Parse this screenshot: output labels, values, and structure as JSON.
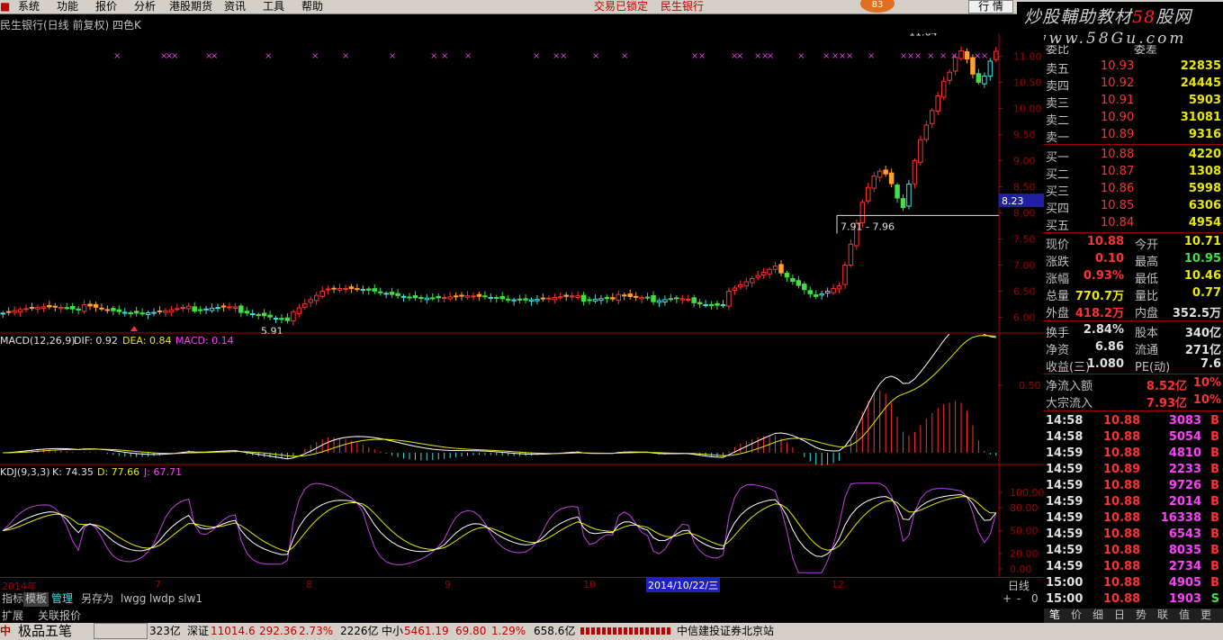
{
  "menu": {
    "items": [
      "系统",
      "功能",
      "报价",
      "分析",
      "港股期货",
      "资讯",
      "工具",
      "帮助"
    ],
    "lock_text": "交易已锁定",
    "stock_name": "民生银行",
    "badge": "83",
    "hangqing_button": "行 情"
  },
  "watermark": {
    "line1_a": "炒股輔助教材",
    "line1_b": "58",
    "line1_c": "股网",
    "line2": "www.58Gu.com"
  },
  "chart": {
    "title": "民生银行(日线 前复权) 四色K",
    "price_axis": [
      "11.00",
      "10.50",
      "10.00",
      "9.50",
      "9.00",
      "8.50",
      "8.00",
      "7.50",
      "7.00",
      "6.50",
      "6.00"
    ],
    "current_price_tag": "8.23",
    "range_label": "7.91 - 7.96",
    "high_label": "11.64",
    "low_label": "5.91",
    "top_label_left": "委比",
    "top_label_right": "委差"
  },
  "macd": {
    "name": "MACD(12,26,9)",
    "dif": "DIF: 0.92",
    "dea": "DEA: 0.84",
    "macd": "MACD: 0.14",
    "axis": "0.50"
  },
  "kdj": {
    "name": "KDJ(9,3,3)",
    "k": "K: 74.35",
    "d": "D: 77.66",
    "j": "J: 67.71",
    "axis": [
      "100.00",
      "80.00",
      "50.00",
      "20.00",
      "0.00"
    ]
  },
  "x_axis": {
    "labels": [
      "2014年",
      "7",
      "8",
      "9",
      "10",
      "12"
    ],
    "cursor_date": "2014/10/22/三",
    "period": "日线",
    "controls": [
      "+",
      "-",
      "0"
    ]
  },
  "bottom_tabs": [
    "指标",
    "模板",
    "管理",
    "另存为",
    "lwgg",
    "lwdp",
    "slw1"
  ],
  "quote": {
    "sell": [
      {
        "label": "卖五",
        "price": "10.93",
        "vol": "22835"
      },
      {
        "label": "卖四",
        "price": "10.92",
        "vol": "24445"
      },
      {
        "label": "卖三",
        "price": "10.91",
        "vol": "5903"
      },
      {
        "label": "卖二",
        "price": "10.90",
        "vol": "31081"
      },
      {
        "label": "卖一",
        "price": "10.89",
        "vol": "9316"
      }
    ],
    "buy": [
      {
        "label": "买一",
        "price": "10.88",
        "vol": "4220"
      },
      {
        "label": "买二",
        "price": "10.87",
        "vol": "1308"
      },
      {
        "label": "买三",
        "price": "10.86",
        "vol": "5998"
      },
      {
        "label": "买四",
        "price": "10.85",
        "vol": "6306"
      },
      {
        "label": "买五",
        "price": "10.84",
        "vol": "4954"
      }
    ],
    "stats": [
      {
        "l1": "现价",
        "v1": "10.88",
        "l2": "今开",
        "v2": "10.71"
      },
      {
        "l1": "涨跌",
        "v1": "0.10",
        "l2": "最高",
        "v2": "10.95"
      },
      {
        "l1": "涨幅",
        "v1": "0.93%",
        "l2": "最低",
        "v2": "10.46"
      },
      {
        "l1": "总量",
        "v1": "770.7万",
        "l2": "量比",
        "v2": "0.77"
      },
      {
        "l1": "外盘",
        "v1": "418.2万",
        "l2": "内盘",
        "v2": "352.5万"
      }
    ],
    "stats2": [
      {
        "l1": "换手",
        "v1": "2.84%",
        "l2": "股本",
        "v2": "340亿"
      },
      {
        "l1": "净资",
        "v1": "6.86",
        "l2": "流通",
        "v2": "271亿"
      },
      {
        "l1": "收益(三)",
        "v1": "1.080",
        "l2": "PE(动)",
        "v2": "7.6"
      }
    ],
    "flows": [
      {
        "label": "净流入额",
        "value": "8.52亿",
        "pct": "10%"
      },
      {
        "label": "大宗流入",
        "value": "7.93亿",
        "pct": "10%"
      }
    ],
    "ticks": [
      {
        "time": "14:58",
        "price": "10.88",
        "vol": "3083",
        "bs": "B"
      },
      {
        "time": "14:58",
        "price": "10.88",
        "vol": "5054",
        "bs": "B"
      },
      {
        "time": "14:59",
        "price": "10.88",
        "vol": "4810",
        "bs": "B"
      },
      {
        "time": "14:59",
        "price": "10.89",
        "vol": "2233",
        "bs": "B"
      },
      {
        "time": "14:59",
        "price": "10.88",
        "vol": "9726",
        "bs": "B"
      },
      {
        "time": "14:59",
        "price": "10.88",
        "vol": "2014",
        "bs": "B"
      },
      {
        "time": "14:59",
        "price": "10.88",
        "vol": "16338",
        "bs": "B"
      },
      {
        "time": "14:59",
        "price": "10.88",
        "vol": "6543",
        "bs": "B"
      },
      {
        "time": "14:59",
        "price": "10.88",
        "vol": "8035",
        "bs": "B"
      },
      {
        "time": "14:59",
        "price": "10.88",
        "vol": "2734",
        "bs": "B"
      },
      {
        "time": "15:00",
        "price": "10.88",
        "vol": "4905",
        "bs": "B"
      },
      {
        "time": "15:00",
        "price": "10.88",
        "vol": "1903",
        "bs": "S"
      }
    ]
  },
  "right_tabs": [
    "笔",
    "价",
    "细",
    "日",
    "势",
    "联",
    "值",
    "更"
  ],
  "extra_tabs": [
    "扩展",
    "关联报价"
  ],
  "status_bar": {
    "ime": "极品五笔",
    "amount1": "323亿",
    "sz_label": "深证",
    "sz_value": "11014.6",
    "sz_change": "292.36",
    "sz_pct": "2.73%",
    "sz_amount": "2226亿",
    "zx_label": "中小",
    "zx_value": "5461.19",
    "zx_change": "69.80",
    "zx_pct": "1.29%",
    "zx_amount": "658.6亿",
    "server": "中信建投证券北京站"
  }
}
